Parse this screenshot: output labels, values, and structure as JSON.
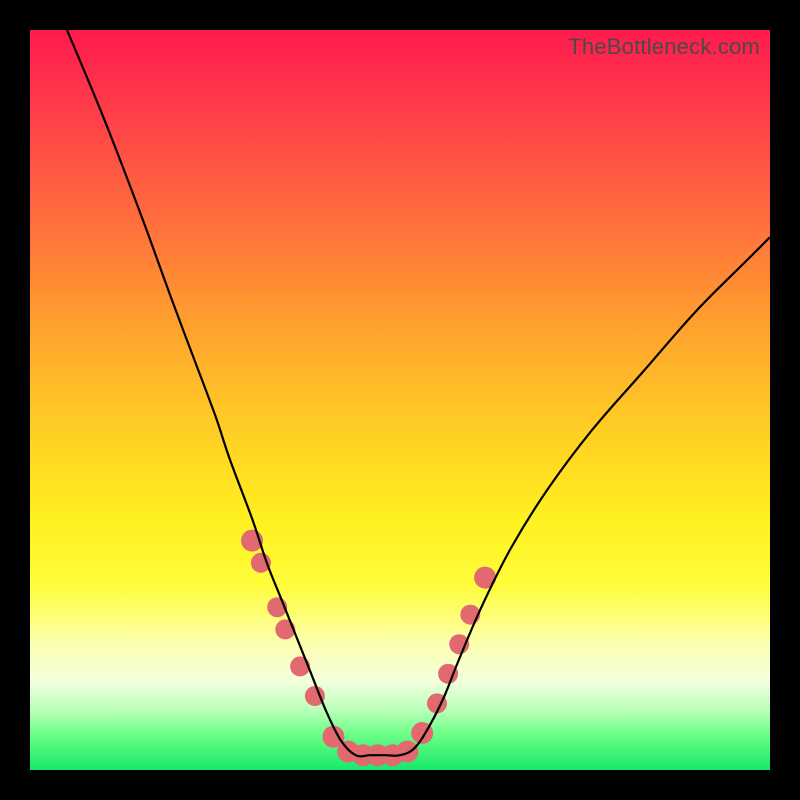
{
  "watermark": "TheBottleneck.com",
  "colors": {
    "dot_fill": "#e2696f",
    "curve_stroke": "#000000",
    "frame_bg_top": "#ff1a4d",
    "frame_bg_bottom": "#17e86b",
    "page_bg": "#000000"
  },
  "chart_data": {
    "type": "line",
    "title": "",
    "xlabel": "",
    "ylabel": "",
    "xlim": [
      0,
      100
    ],
    "ylim": [
      0,
      100
    ],
    "grid": false,
    "note": "Values estimated from pixel positions; y = bottleneck % (0 = best/green, 100 = worst/red). Curve minimum is the flat segment near x≈42–50 at y≈2.",
    "series": [
      {
        "name": "bottleneck-curve",
        "x": [
          5,
          10,
          15,
          19,
          22,
          25,
          27,
          30,
          32,
          34,
          36,
          38,
          40,
          42,
          44,
          46,
          48,
          50,
          52,
          54,
          56,
          58,
          61,
          65,
          70,
          76,
          83,
          90,
          97,
          100
        ],
        "y": [
          100,
          88,
          75,
          64,
          56,
          48,
          42,
          34,
          28,
          23,
          18,
          13,
          8,
          4,
          2,
          2,
          2,
          2,
          3,
          6,
          10,
          15,
          22,
          30,
          38,
          46,
          54,
          62,
          69,
          72
        ]
      }
    ],
    "markers": {
      "name": "highlight-dots",
      "x": [
        30.0,
        31.2,
        33.4,
        34.5,
        36.5,
        38.5,
        41.0,
        43.0,
        45.0,
        47.0,
        49.0,
        51.0,
        53.0,
        55.0,
        56.5,
        58.0,
        59.5,
        61.5
      ],
      "y": [
        31.0,
        28.0,
        22.0,
        19.0,
        14.0,
        10.0,
        4.5,
        2.5,
        2.0,
        2.0,
        2.0,
        2.5,
        5.0,
        9.0,
        13.0,
        17.0,
        21.0,
        26.0
      ],
      "r": [
        11,
        10,
        10,
        10,
        10,
        10,
        11,
        11,
        11,
        11,
        11,
        11,
        11,
        10,
        10,
        10,
        10,
        11
      ]
    }
  }
}
